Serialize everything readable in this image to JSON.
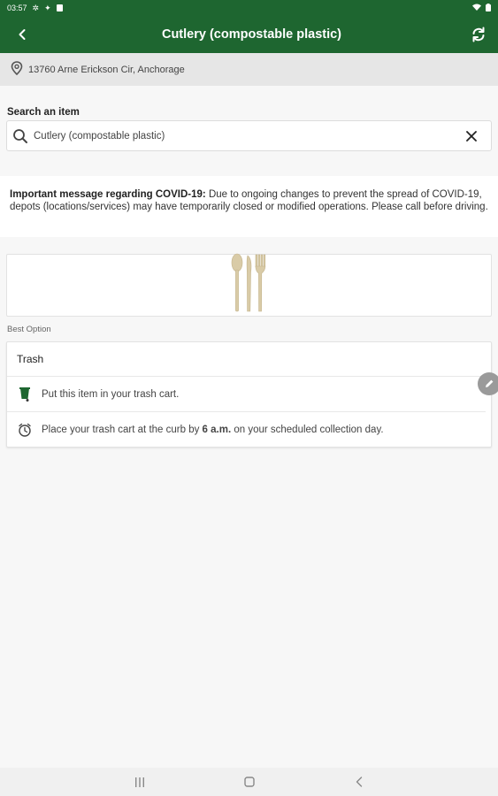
{
  "status_bar": {
    "time": "03:57",
    "icons": [
      "settings-icon",
      "nfc-icon",
      "sim-icon",
      "wifi-icon",
      "battery-icon"
    ]
  },
  "app_bar": {
    "title": "Cutlery (compostable plastic)",
    "icons": [
      "back-arrow-icon",
      "refresh-icon"
    ]
  },
  "address": {
    "text": "13760 Arne Erickson Cir, Anchorage",
    "icon": "location-pin-icon"
  },
  "search": {
    "label": "Search an item",
    "value": "Cutlery (compostable plastic)",
    "icons": [
      "search-icon",
      "clear-icon"
    ]
  },
  "notice": {
    "heading": "Important message regarding COVID-19:",
    "body": " Due to ongoing changes to prevent the spread of COVID-19, depots (locations/services) may have temporarily closed or modified operations. Please call before driving."
  },
  "item_image": {
    "icon": "cutlery-icon"
  },
  "best_option": {
    "label": "Best Option",
    "title": "Trash",
    "steps": [
      {
        "icon": "trash-cart-icon",
        "text": "Put this item in your trash cart."
      },
      {
        "icon": "clock-icon",
        "text_before": "Place your trash cart at the curb by ",
        "text_bold": "6 a.m.",
        "text_after": " on your scheduled collection day."
      }
    ]
  },
  "fab": {
    "icon": "edit-pencil-icon"
  },
  "nav_bar": {
    "icons": [
      "recents-icon",
      "home-icon",
      "back-icon"
    ]
  },
  "colors": {
    "primary": "#1e6630",
    "background": "#f7f7f7",
    "accent_fab": "#9a9a9a"
  }
}
